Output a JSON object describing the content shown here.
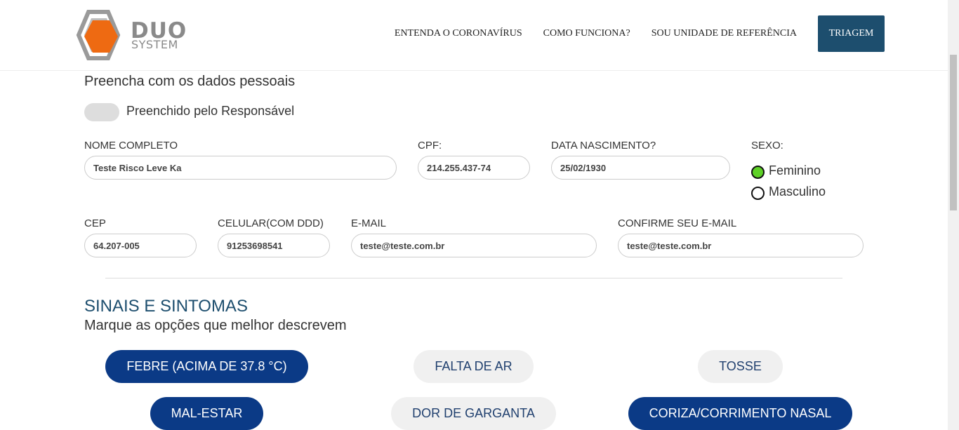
{
  "header": {
    "logo": {
      "line1": "DUO",
      "line2": "SYSTEM"
    },
    "nav": [
      {
        "label": "ENTENDA O CORONAVÍRUS"
      },
      {
        "label": "COMO FUNCIONA?"
      },
      {
        "label": "SOU UNIDADE DE REFERÊNCIA"
      }
    ],
    "cta_label": "TRIAGEM",
    "cta_color": "#1d4e6e"
  },
  "form": {
    "title": "Preencha com os dados pessoais",
    "responsavel_toggle": {
      "label": "Preenchido pelo Responsável",
      "on": false
    },
    "fields": {
      "nome": {
        "label": "NOME COMPLETO",
        "value": "Teste Risco Leve Ka"
      },
      "cpf": {
        "label": "CPF:",
        "value": "214.255.437-74"
      },
      "nascimento": {
        "label": "DATA NASCIMENTO?",
        "value": "25/02/1930"
      },
      "cep": {
        "label": "CEP",
        "value": "64.207-005"
      },
      "celular": {
        "label": "CELULAR(COM DDD)",
        "value": "91253698541"
      },
      "email": {
        "label": "E-MAIL",
        "value": "teste@teste.com.br"
      },
      "email_confirm": {
        "label": "CONFIRME SEU E-MAIL",
        "value": "teste@teste.com.br"
      }
    },
    "sexo": {
      "label": "SEXO:",
      "options": [
        {
          "label": "Feminino",
          "selected": true
        },
        {
          "label": "Masculino",
          "selected": false
        }
      ],
      "selected_color": "#5ed127"
    }
  },
  "symptoms": {
    "title": "SINAIS E SINTOMAS",
    "subtitle": "Marque as opções que melhor descrevem",
    "items": [
      {
        "label": "FEBRE (ACIMA DE 37.8 °C)",
        "selected": true
      },
      {
        "label": "FALTA DE AR",
        "selected": false
      },
      {
        "label": "TOSSE",
        "selected": false
      },
      {
        "label": "MAL-ESTAR",
        "selected": true
      },
      {
        "label": "DOR DE GARGANTA",
        "selected": false
      },
      {
        "label": "CORIZA/CORRIMENTO NASAL",
        "selected": true
      }
    ],
    "selected_color": "#0b3a86",
    "unselected_color": "#f0f0f0"
  }
}
